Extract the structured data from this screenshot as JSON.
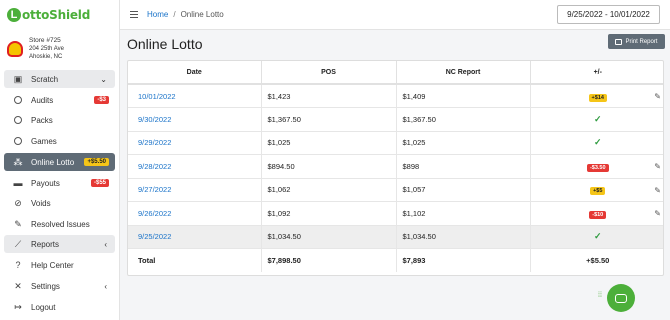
{
  "brand": {
    "logo_letter": "L",
    "logo_text": "ottoShield",
    "accent": "#4caf3a"
  },
  "store": {
    "name": "Store #725",
    "address": "204 25th Ave",
    "city": "Ahoskie, NC"
  },
  "nav": {
    "scratch": "Scratch",
    "audits": "Audits",
    "audits_badge": "-$3",
    "packs": "Packs",
    "games": "Games",
    "online_lotto": "Online Lotto",
    "online_lotto_badge": "+$5.50",
    "payouts": "Payouts",
    "payouts_badge": "-$55",
    "voids": "Voids",
    "resolved": "Resolved Issues",
    "reports": "Reports",
    "help": "Help Center",
    "settings": "Settings",
    "logout": "Logout"
  },
  "breadcrumb": {
    "home": "Home",
    "current": "Online Lotto"
  },
  "date_range": "9/25/2022 - 10/01/2022",
  "page_title": "Online Lotto",
  "print_label": "Print Report",
  "table": {
    "headers": [
      "Date",
      "POS",
      "NC Report",
      "+/-"
    ],
    "rows": [
      {
        "date": "10/01/2022",
        "pos": "$1,423",
        "nc": "$1,409",
        "diff": "+$14",
        "diff_color": "yellow",
        "editable": true,
        "shaded": false
      },
      {
        "date": "9/30/2022",
        "pos": "$1,367.50",
        "nc": "$1,367.50",
        "diff": "",
        "diff_color": "check",
        "editable": false,
        "shaded": false
      },
      {
        "date": "9/29/2022",
        "pos": "$1,025",
        "nc": "$1,025",
        "diff": "",
        "diff_color": "check",
        "editable": false,
        "shaded": false
      },
      {
        "date": "9/28/2022",
        "pos": "$894.50",
        "nc": "$898",
        "diff": "-$3.50",
        "diff_color": "red",
        "editable": true,
        "shaded": false
      },
      {
        "date": "9/27/2022",
        "pos": "$1,062",
        "nc": "$1,057",
        "diff": "+$5",
        "diff_color": "yellow",
        "editable": true,
        "shaded": false
      },
      {
        "date": "9/26/2022",
        "pos": "$1,092",
        "nc": "$1,102",
        "diff": "-$10",
        "diff_color": "red",
        "editable": true,
        "shaded": false
      },
      {
        "date": "9/25/2022",
        "pos": "$1,034.50",
        "nc": "$1,034.50",
        "diff": "",
        "diff_color": "check",
        "editable": false,
        "shaded": true
      }
    ],
    "total": {
      "label": "Total",
      "pos": "$7,898.50",
      "nc": "$7,893",
      "diff": "+$5.50"
    }
  },
  "icons": {
    "edit": "pencil-icon",
    "ok": "check-icon",
    "chat": "chat-icon"
  }
}
